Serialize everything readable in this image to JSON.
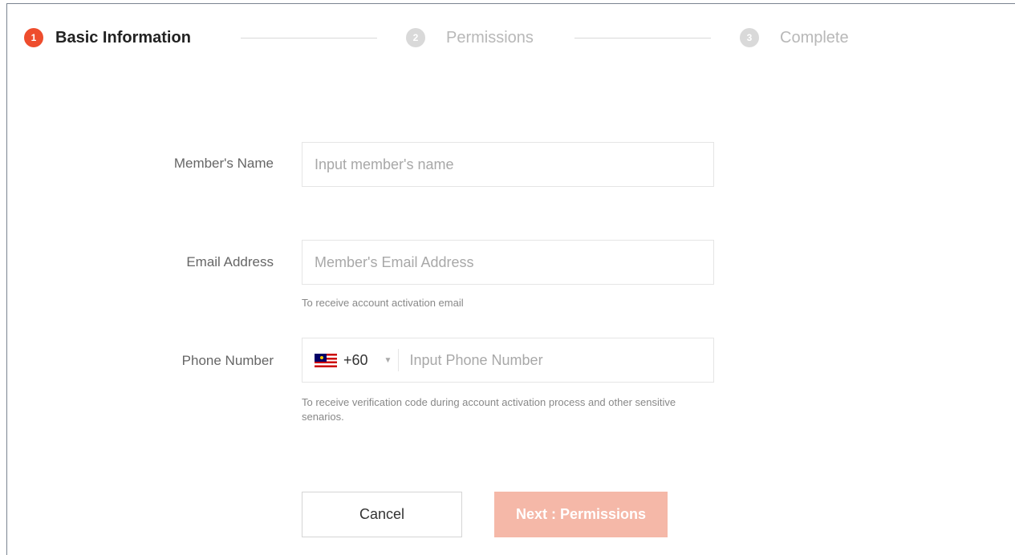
{
  "stepper": {
    "steps": [
      {
        "number": "1",
        "label": "Basic Information",
        "state": "active"
      },
      {
        "number": "2",
        "label": "Permissions",
        "state": "inactive"
      },
      {
        "number": "3",
        "label": "Complete",
        "state": "inactive"
      }
    ]
  },
  "form": {
    "name": {
      "label": "Member's Name",
      "placeholder": "Input member's name",
      "value": ""
    },
    "email": {
      "label": "Email Address",
      "placeholder": "Member's Email Address",
      "value": "",
      "hint": "To receive account activation email"
    },
    "phone": {
      "label": "Phone Number",
      "country_flag": "malaysia-flag-icon",
      "dial_code": "+60",
      "dropdown_icon": "caret-down-icon",
      "placeholder": "Input Phone Number",
      "value": "",
      "hint": "To receive verification code during account activation process and other sensitive senarios."
    }
  },
  "actions": {
    "cancel_label": "Cancel",
    "next_label": "Next : Permissions"
  },
  "colors": {
    "accent": "#ee4d2d",
    "next_button_disabled": "#f5b8a8"
  }
}
